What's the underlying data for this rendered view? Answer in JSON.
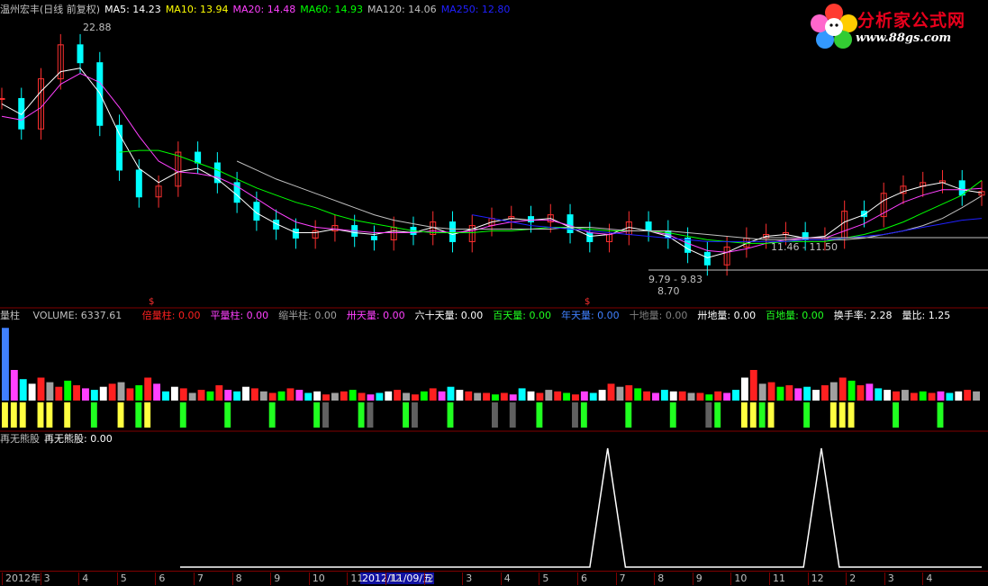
{
  "price_legend": {
    "title": "温州宏丰(日线 前复权)",
    "ma5": "MA5: 14.23",
    "ma10": "MA10: 13.94",
    "ma20": "MA20: 14.48",
    "ma60": "MA60: 14.93",
    "ma120": "MA120: 14.06",
    "ma250": "MA250: 12.80"
  },
  "price_annotations": {
    "high": "22.88",
    "zone1": "11.46 - 11.50",
    "zone2": "9.79 - 9.83",
    "low": "8.70"
  },
  "volume_legend": {
    "title": "量柱",
    "volume": "VOLUME: 6337.61",
    "items": [
      {
        "text": "倍量柱: 0.00",
        "color": "#ff2020"
      },
      {
        "text": "平量柱: 0.00",
        "color": "#ff40ff"
      },
      {
        "text": "缩半柱: 0.00",
        "color": "#a0a0a0"
      },
      {
        "text": "卅天量: 0.00",
        "color": "#ff40ff"
      },
      {
        "text": "六十天量: 0.00",
        "color": "#ffffff"
      },
      {
        "text": "百天量: 0.00",
        "color": "#20ff20"
      },
      {
        "text": "年天量: 0.00",
        "color": "#4080ff"
      },
      {
        "text": "十地量: 0.00",
        "color": "#808080"
      },
      {
        "text": "卅地量: 0.00",
        "color": "#ffffff"
      },
      {
        "text": "百地量: 0.00",
        "color": "#20ff20"
      },
      {
        "text": "换手率: 2.28",
        "color": "#ffffff"
      },
      {
        "text": "量比: 1.25",
        "color": "#ffffff"
      }
    ]
  },
  "indicator_legend": {
    "title": "再无熊股",
    "value": "再无熊股: 0.00"
  },
  "watermark": {
    "title": "分析家公式网",
    "url": "www.88gs.com"
  },
  "time_axis": {
    "labels": [
      "2012年",
      "3",
      "4",
      "5",
      "6",
      "7",
      "8",
      "9",
      "10",
      "11",
      "12",
      "2",
      "3",
      "4",
      "5",
      "6",
      "7",
      "8",
      "9",
      "10",
      "11",
      "12",
      "2",
      "3",
      "4"
    ],
    "cursor_date": "2012/11/09/五"
  },
  "colors": {
    "up": "#ff3030",
    "down": "#00ffff",
    "ma5": "#ffffff",
    "ma10": "#ffff00",
    "ma20": "#ff40ff",
    "ma60": "#00ff00",
    "ma120": "#c0c0c0",
    "ma250": "#2020ff"
  },
  "chart_data": [
    {
      "type": "line",
      "title": "温州宏丰(日线 前复权)",
      "series": [
        {
          "name": "close",
          "values": [
            19.5,
            17.8,
            20.6,
            22.5,
            21.5,
            18.0,
            15.5,
            14.0,
            14.6,
            16.5,
            15.9,
            14.8,
            13.7,
            12.7,
            12.2,
            11.7,
            12.1,
            12.4,
            11.8,
            11.6,
            12.3,
            11.9,
            12.6,
            11.5,
            12.4,
            12.8,
            12.9,
            12.6,
            13.0,
            12.0,
            11.5,
            11.9,
            12.6,
            12.1,
            11.7,
            10.9,
            10.2,
            11.2,
            11.7,
            11.9,
            12.0,
            11.6,
            11.7,
            13.2,
            12.9,
            14.2,
            14.6,
            14.8,
            14.9,
            14.1,
            14.3
          ]
        },
        {
          "name": "MA5",
          "values": [
            19.2,
            18.6,
            19.9,
            21.0,
            21.2,
            19.8,
            17.5,
            15.6,
            14.8,
            15.4,
            15.6,
            15.0,
            14.1,
            13.1,
            12.5,
            12.0,
            12.0,
            12.2,
            12.0,
            11.9,
            12.1,
            12.0,
            12.3,
            11.9,
            12.2,
            12.6,
            12.8,
            12.7,
            12.8,
            12.3,
            11.8,
            11.9,
            12.3,
            12.1,
            11.8,
            11.1,
            10.6,
            10.9,
            11.4,
            11.8,
            11.9,
            11.7,
            11.8,
            12.6,
            13.0,
            13.8,
            14.3,
            14.6,
            14.8,
            14.4,
            14.23
          ]
        },
        {
          "name": "MA20",
          "values": [
            18.5,
            18.3,
            19.0,
            20.3,
            20.9,
            20.4,
            19.0,
            17.4,
            16.0,
            15.4,
            15.3,
            15.1,
            14.6,
            13.9,
            13.2,
            12.6,
            12.3,
            12.2,
            12.1,
            12.0,
            12.0,
            12.0,
            12.1,
            12.0,
            12.1,
            12.4,
            12.6,
            12.7,
            12.7,
            12.4,
            12.0,
            11.9,
            12.1,
            12.1,
            11.9,
            11.4,
            11.0,
            10.9,
            11.1,
            11.4,
            11.6,
            11.7,
            11.7,
            12.1,
            12.5,
            13.1,
            13.7,
            14.1,
            14.4,
            14.4,
            14.48
          ]
        },
        {
          "name": "MA60",
          "values": [
            null,
            null,
            null,
            null,
            null,
            null,
            16.5,
            16.6,
            16.6,
            16.3,
            15.9,
            15.5,
            15.0,
            14.5,
            14.1,
            13.7,
            13.4,
            13.0,
            12.7,
            12.5,
            12.3,
            12.1,
            12.0,
            12.0,
            12.0,
            12.1,
            12.1,
            12.2,
            12.3,
            12.3,
            12.2,
            12.1,
            12.1,
            12.1,
            12.0,
            11.8,
            11.6,
            11.5,
            11.4,
            11.4,
            11.5,
            11.5,
            11.5,
            11.7,
            11.9,
            12.2,
            12.6,
            13.1,
            13.6,
            14.1,
            14.93
          ]
        },
        {
          "name": "MA120",
          "values": [
            null,
            null,
            null,
            null,
            null,
            null,
            null,
            null,
            null,
            null,
            null,
            null,
            16.0,
            15.5,
            15.0,
            14.6,
            14.2,
            13.8,
            13.4,
            13.0,
            12.7,
            12.5,
            12.3,
            12.2,
            12.2,
            12.2,
            12.2,
            12.2,
            12.2,
            12.3,
            12.3,
            12.2,
            12.1,
            12.1,
            12.1,
            12.0,
            11.9,
            11.8,
            11.7,
            11.6,
            11.6,
            11.6,
            11.6,
            11.6,
            11.7,
            11.9,
            12.1,
            12.4,
            12.8,
            13.4,
            14.06
          ]
        },
        {
          "name": "MA250",
          "values": [
            null,
            null,
            null,
            null,
            null,
            null,
            null,
            null,
            null,
            null,
            null,
            null,
            null,
            null,
            null,
            null,
            null,
            null,
            null,
            null,
            null,
            null,
            null,
            null,
            13.0,
            12.8,
            12.6,
            12.4,
            12.3,
            12.2,
            12.1,
            12.0,
            11.9,
            11.8,
            11.7,
            11.6,
            11.5,
            11.5,
            11.5,
            11.5,
            11.5,
            11.6,
            11.6,
            11.7,
            11.8,
            11.9,
            12.1,
            12.3,
            12.5,
            12.7,
            12.8
          ]
        }
      ],
      "ylim": [
        8.0,
        24.0
      ]
    },
    {
      "type": "bar",
      "title": "量柱",
      "series": [
        {
          "name": "VOLUME",
          "values": [
            95,
            40,
            28,
            22,
            30,
            24,
            18,
            26,
            20,
            16,
            14,
            18,
            22,
            24,
            16,
            20,
            30,
            22,
            12,
            18,
            16,
            10,
            14,
            12,
            20,
            14,
            12,
            18,
            16,
            12,
            10,
            12,
            16,
            14,
            10,
            12,
            8,
            10,
            12,
            14,
            10,
            8,
            10,
            12,
            14,
            10,
            8,
            12,
            16,
            12,
            18,
            14,
            12,
            10,
            10,
            8,
            10,
            8,
            16,
            12,
            10,
            14,
            12,
            10,
            8,
            12,
            10,
            14,
            22,
            18,
            20,
            16,
            12,
            10,
            14,
            12,
            12,
            10,
            10,
            8,
            12,
            10,
            14,
            30,
            40,
            22,
            24,
            18,
            20,
            16,
            18,
            14,
            20,
            24,
            30,
            26,
            20,
            22,
            16,
            14,
            12,
            14,
            10,
            12,
            10,
            12,
            10,
            12,
            14,
            12
          ]
        }
      ]
    },
    {
      "type": "line",
      "title": "再无熊股",
      "series": [
        {
          "name": "再无熊股",
          "values": [
            0,
            0,
            0,
            0,
            0,
            0,
            0,
            0,
            0,
            0,
            0,
            0,
            0,
            0,
            0,
            0,
            0,
            0,
            0,
            0,
            0,
            0,
            0,
            0,
            1,
            0,
            0,
            0,
            0,
            0,
            0,
            0,
            0,
            0,
            0,
            0,
            1,
            0,
            0,
            0,
            0,
            0,
            0,
            0,
            0,
            0
          ]
        }
      ],
      "ylim": [
        0,
        1
      ]
    }
  ]
}
